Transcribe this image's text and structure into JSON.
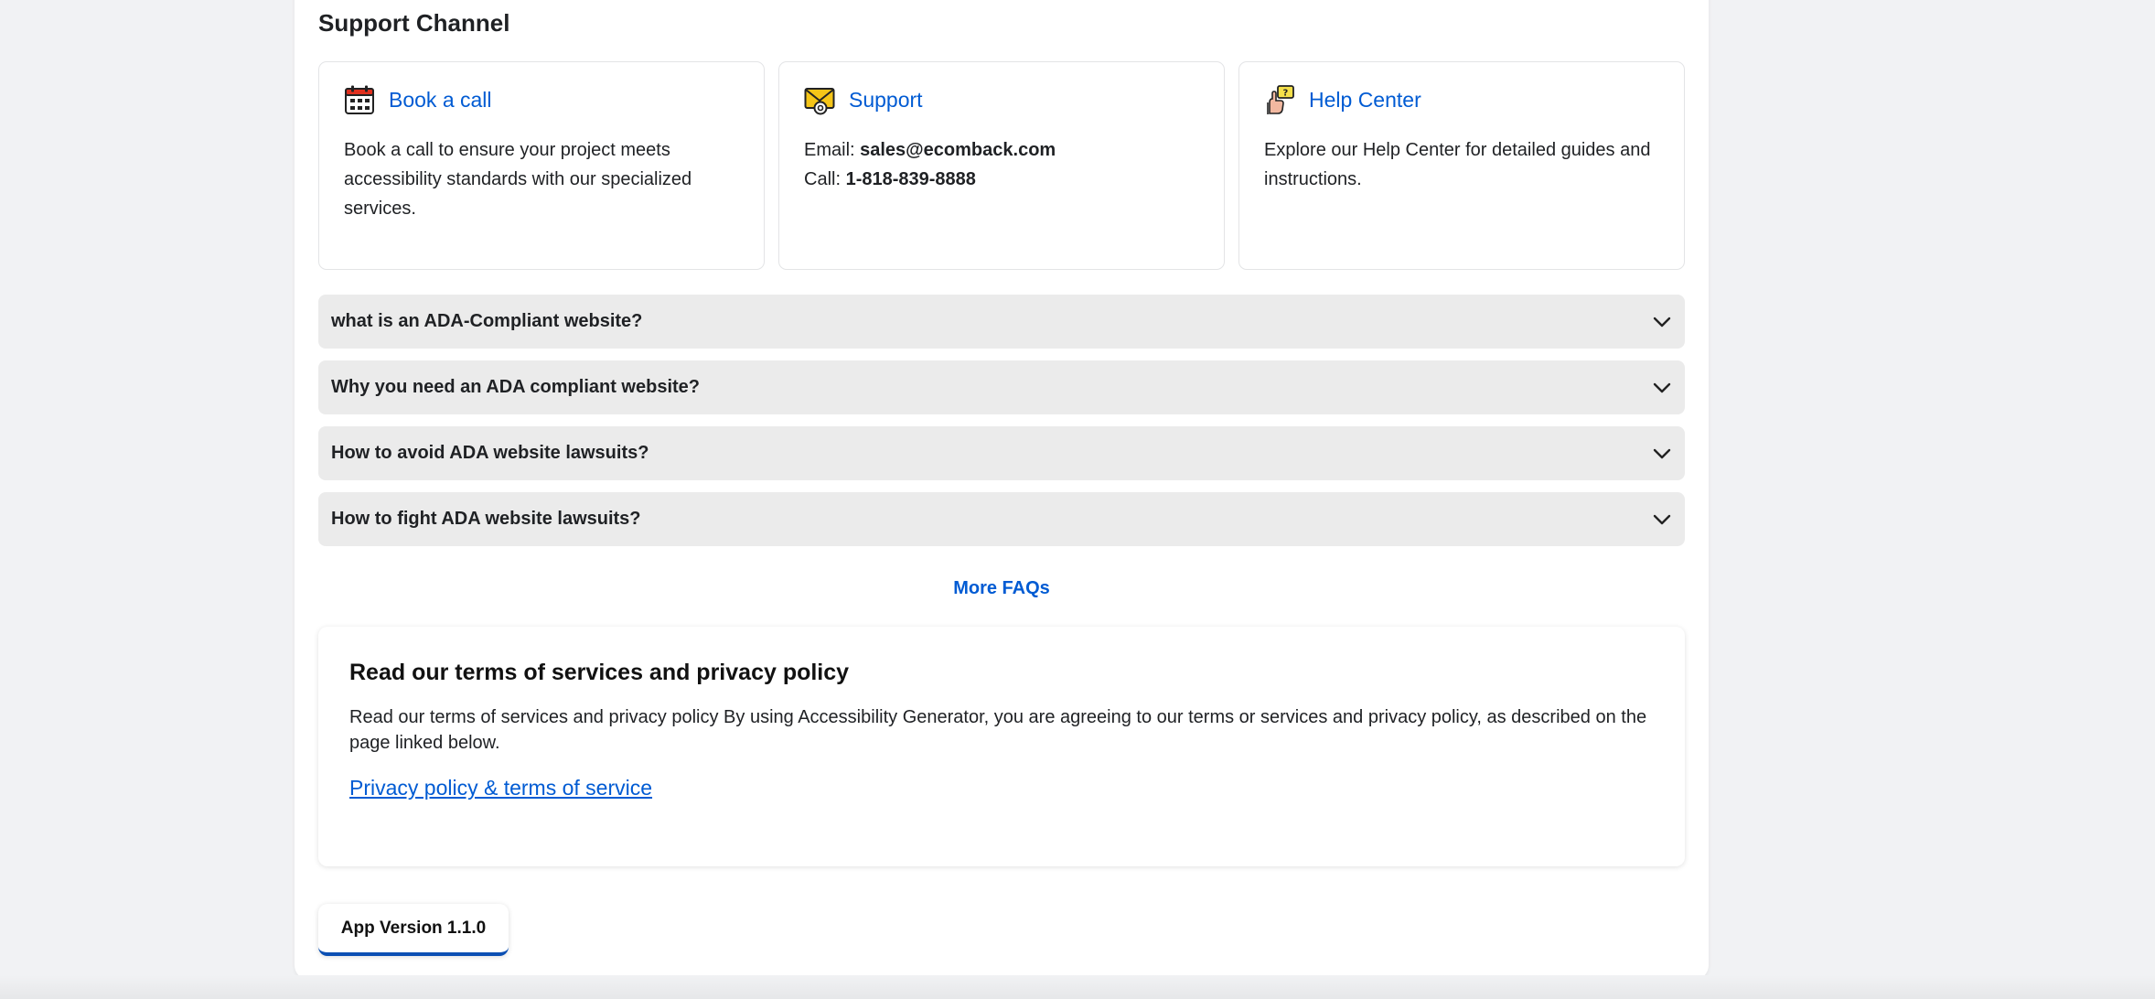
{
  "support": {
    "title": "Support Channel",
    "cards": [
      {
        "icon": "calendar-icon",
        "title": "Book a call",
        "text": "Book a call to ensure your project meets accessibility standards with our specialized services."
      },
      {
        "icon": "mail-icon",
        "title": "Support",
        "email_label": "Email: ",
        "email": "sales@ecomback.com",
        "call_label": "Call: ",
        "phone": "1-818-839-8888"
      },
      {
        "icon": "help-hand-icon",
        "title": "Help Center",
        "text": "Explore our Help Center for detailed guides and instructions."
      }
    ]
  },
  "faqs": [
    {
      "question": "what is an ADA-Compliant website?"
    },
    {
      "question": "Why you need an ADA compliant website?"
    },
    {
      "question": "How to avoid ADA website lawsuits?"
    },
    {
      "question": "How to fight ADA website lawsuits?"
    }
  ],
  "more_faqs_label": "More FAQs",
  "terms": {
    "title": "Read our terms of services and privacy policy",
    "body": "Read our terms of services and privacy policy By using Accessibility Generator, you are agreeing to our terms or services and privacy policy, as described on the page linked below.",
    "link": "Privacy policy & terms of service"
  },
  "app_version": "App Version 1.1.0",
  "colors": {
    "accent": "#005bd3",
    "faq_bg": "#ebebeb",
    "version_border": "#0b4fb3"
  }
}
